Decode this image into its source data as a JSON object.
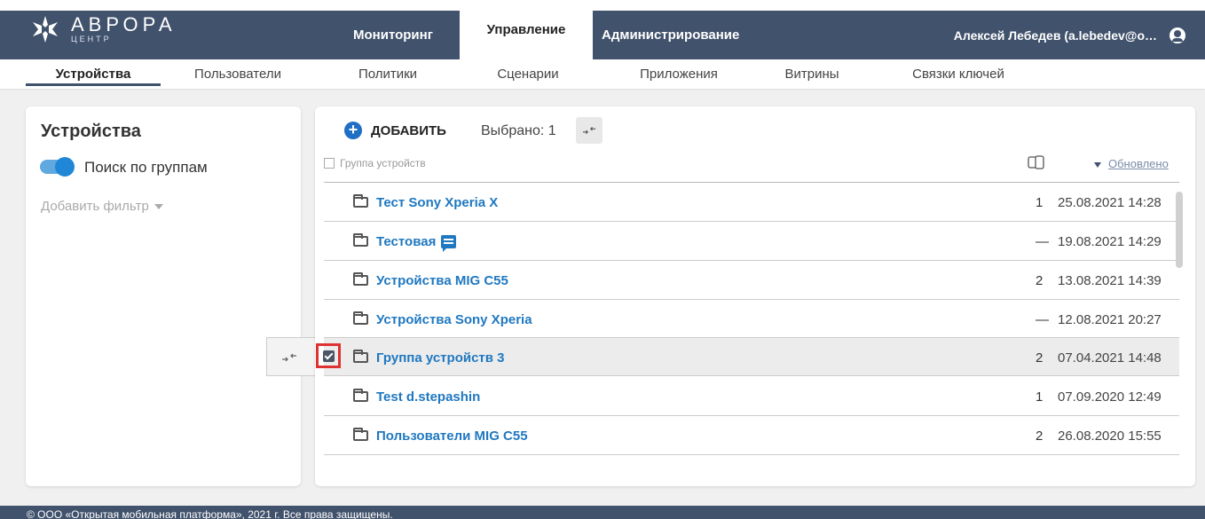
{
  "brand": {
    "title": "АВРОРА",
    "subtitle": "ЦЕНТР"
  },
  "main_nav": [
    {
      "label": "Мониторинг",
      "active": false
    },
    {
      "label": "Управление",
      "active": true
    },
    {
      "label": "Администрирование",
      "active": false
    }
  ],
  "user": {
    "name": "Алексей Лебедев (a.lebedev@o…"
  },
  "sub_nav": [
    {
      "label": "Устройства",
      "active": true
    },
    {
      "label": "Пользователи"
    },
    {
      "label": "Политики"
    },
    {
      "label": "Сценарии"
    },
    {
      "label": "Приложения"
    },
    {
      "label": "Витрины"
    },
    {
      "label": "Связки ключей"
    }
  ],
  "left_panel": {
    "title": "Устройства",
    "toggle_label": "Поиск по группам",
    "toggle_on": true,
    "add_filter": "Добавить фильтр"
  },
  "toolbar": {
    "add_label": "ДОБАВИТЬ",
    "selected_label": "Выбрано: 1"
  },
  "table": {
    "col_group": "Группа устройств",
    "col_updated": "Обновлено",
    "rows": [
      {
        "name": "Тест Sony Xperia X",
        "count": "1",
        "date": "25.08.2021 14:28",
        "comment": false,
        "selected": false
      },
      {
        "name": "Тестовая",
        "count": "—",
        "date": "19.08.2021 14:29",
        "comment": true,
        "selected": false
      },
      {
        "name": "Устройства MIG C55",
        "count": "2",
        "date": "13.08.2021 14:39",
        "comment": false,
        "selected": false
      },
      {
        "name": "Устройства Sony Xperia",
        "count": "—",
        "date": "12.08.2021 20:27",
        "comment": false,
        "selected": false
      },
      {
        "name": "Группа устройств 3",
        "count": "2",
        "date": "07.04.2021 14:48",
        "comment": false,
        "selected": true
      },
      {
        "name": "Test d.stepashin",
        "count": "1",
        "date": "07.09.2020 12:49",
        "comment": false,
        "selected": false
      },
      {
        "name": "Пользователи MIG C55",
        "count": "2",
        "date": "26.08.2020 15:55",
        "comment": false,
        "selected": false
      }
    ]
  },
  "footer": {
    "text": "© ООО «Открытая мобильная платформа», 2021 г. Все права защищены."
  },
  "colors": {
    "header": "#41526c",
    "link": "#1f78c1",
    "accent": "#1f6fc5",
    "highlight": "#e03131"
  }
}
